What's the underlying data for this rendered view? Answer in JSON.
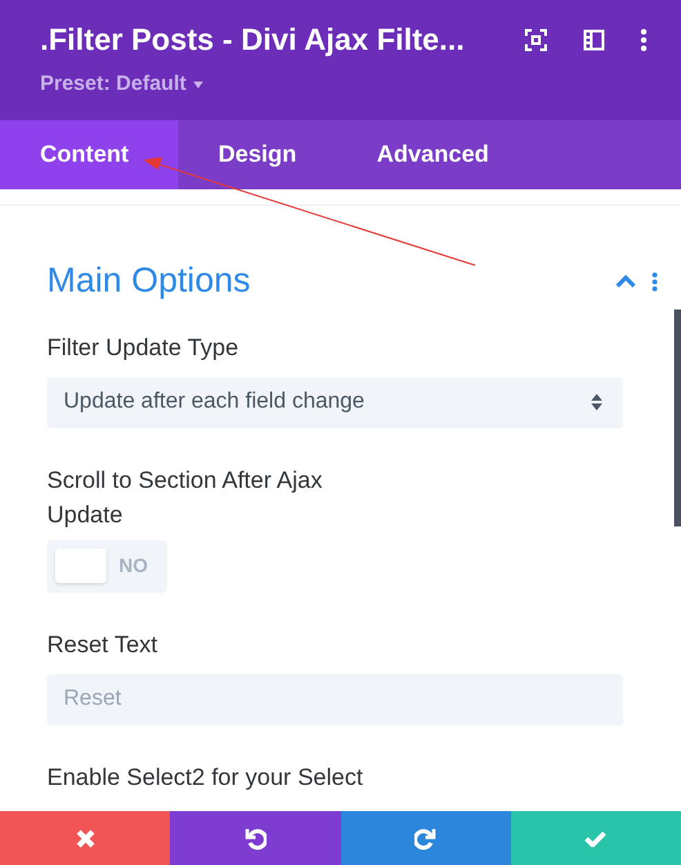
{
  "header": {
    "title": ".Filter Posts - Divi Ajax Filte...",
    "preset": "Preset: Default"
  },
  "tabs": [
    {
      "label": "Content",
      "selected": true
    },
    {
      "label": "Design",
      "selected": false
    },
    {
      "label": "Advanced",
      "selected": false
    }
  ],
  "section": {
    "title": "Main Options",
    "expanded": true
  },
  "fields": [
    {
      "kind": "select",
      "label": "Filter Update Type",
      "value": "Update after each field change"
    },
    {
      "kind": "toggle",
      "label": "Scroll to Section After Ajax Update",
      "on": false,
      "state_text": "NO"
    },
    {
      "kind": "text",
      "label": "Reset Text",
      "placeholder": "Reset"
    },
    {
      "kind": "label",
      "label": "Enable Select2 for your Select"
    }
  ],
  "footer": [
    {
      "kind": "discard"
    },
    {
      "kind": "undo"
    },
    {
      "kind": "redo"
    },
    {
      "kind": "save"
    }
  ]
}
